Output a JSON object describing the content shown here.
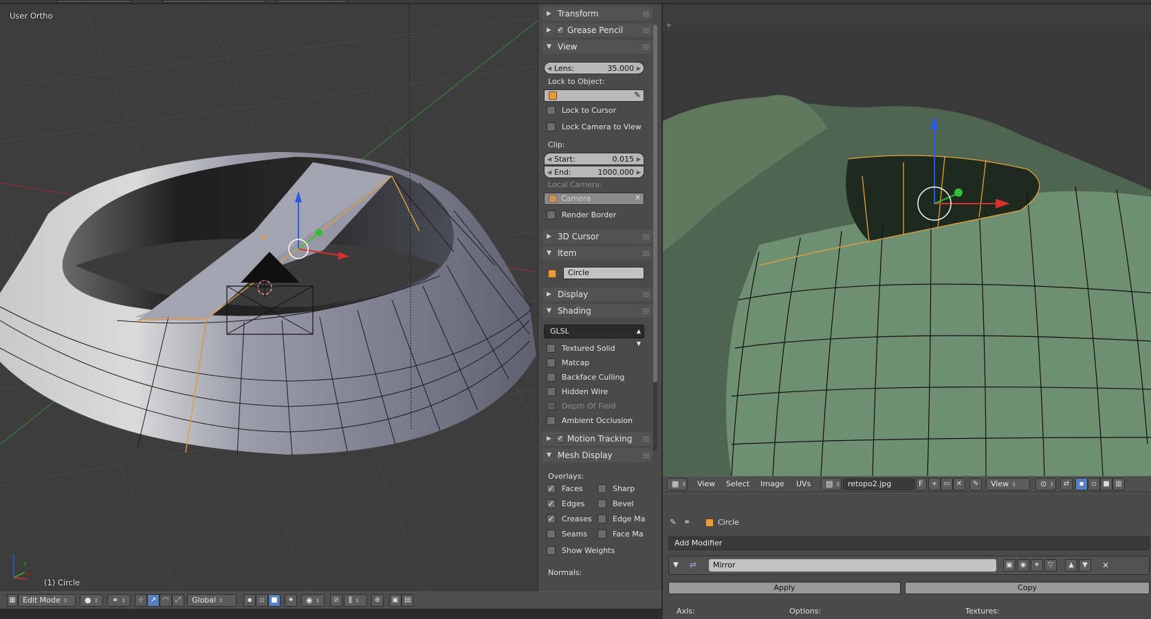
{
  "left_viewport": {
    "view_label": "User Ortho",
    "object_label": "(1) Circle",
    "axis_x": "x",
    "axis_y": "y"
  },
  "left_header": {
    "mode": "Edit Mode",
    "orientation": "Global"
  },
  "n_panel": {
    "transform": "Transform",
    "grease_pencil": "Grease Pencil",
    "view": "View",
    "lens_label": "Lens:",
    "lens_value": "35.000",
    "lock_to_object": "Lock to Object:",
    "lock_to_cursor": "Lock to Cursor",
    "lock_camera_to_view": "Lock Camera to View",
    "clip": "Clip:",
    "clip_start_label": "Start:",
    "clip_start_value": "0.015",
    "clip_end_label": "End:",
    "clip_end_value": "1000.000",
    "local_camera": "Local Camera:",
    "camera": "Camera",
    "render_border": "Render Border",
    "cursor_3d": "3D Cursor",
    "item": "Item",
    "item_name": "Circle",
    "display": "Display",
    "shading": "Shading",
    "shading_mode": "GLSL",
    "textured_solid": "Textured Solid",
    "matcap": "Matcap",
    "backface_culling": "Backface Culling",
    "hidden_wire": "Hidden Wire",
    "depth_of_field": "Depth Of Field",
    "ambient_occlusion": "Ambient Occlusion",
    "motion_tracking": "Motion Tracking",
    "mesh_display": "Mesh Display",
    "overlays": "Overlays:",
    "faces": "Faces",
    "sharp": "Sharp",
    "edges": "Edges",
    "bevel": "Bevel",
    "creases": "Creases",
    "edge_marks": "Edge Ma",
    "seams": "Seams",
    "face_marks": "Face Ma",
    "show_weights": "Show Weights",
    "normals": "Normals:"
  },
  "uv_header": {
    "view": "View",
    "select": "Select",
    "image": "Image",
    "uvs": "UVs",
    "image_name": "retopo2.jpg",
    "fake_user": "F",
    "view_dropdown": "View"
  },
  "properties": {
    "object_name": "Circle",
    "add_modifier": "Add Modifier",
    "modifier_name": "Mirror",
    "apply": "Apply",
    "copy": "Copy",
    "axis": "Axis:",
    "options": "Options:",
    "textures": "Textures:"
  },
  "colors": {
    "selection_orange": "#e8a040",
    "axis_red": "#d83030",
    "axis_green": "#30c030",
    "axis_blue": "#2a5ae0",
    "sculpt_green": "#6f8f72",
    "active_blue": "#5680c2"
  }
}
